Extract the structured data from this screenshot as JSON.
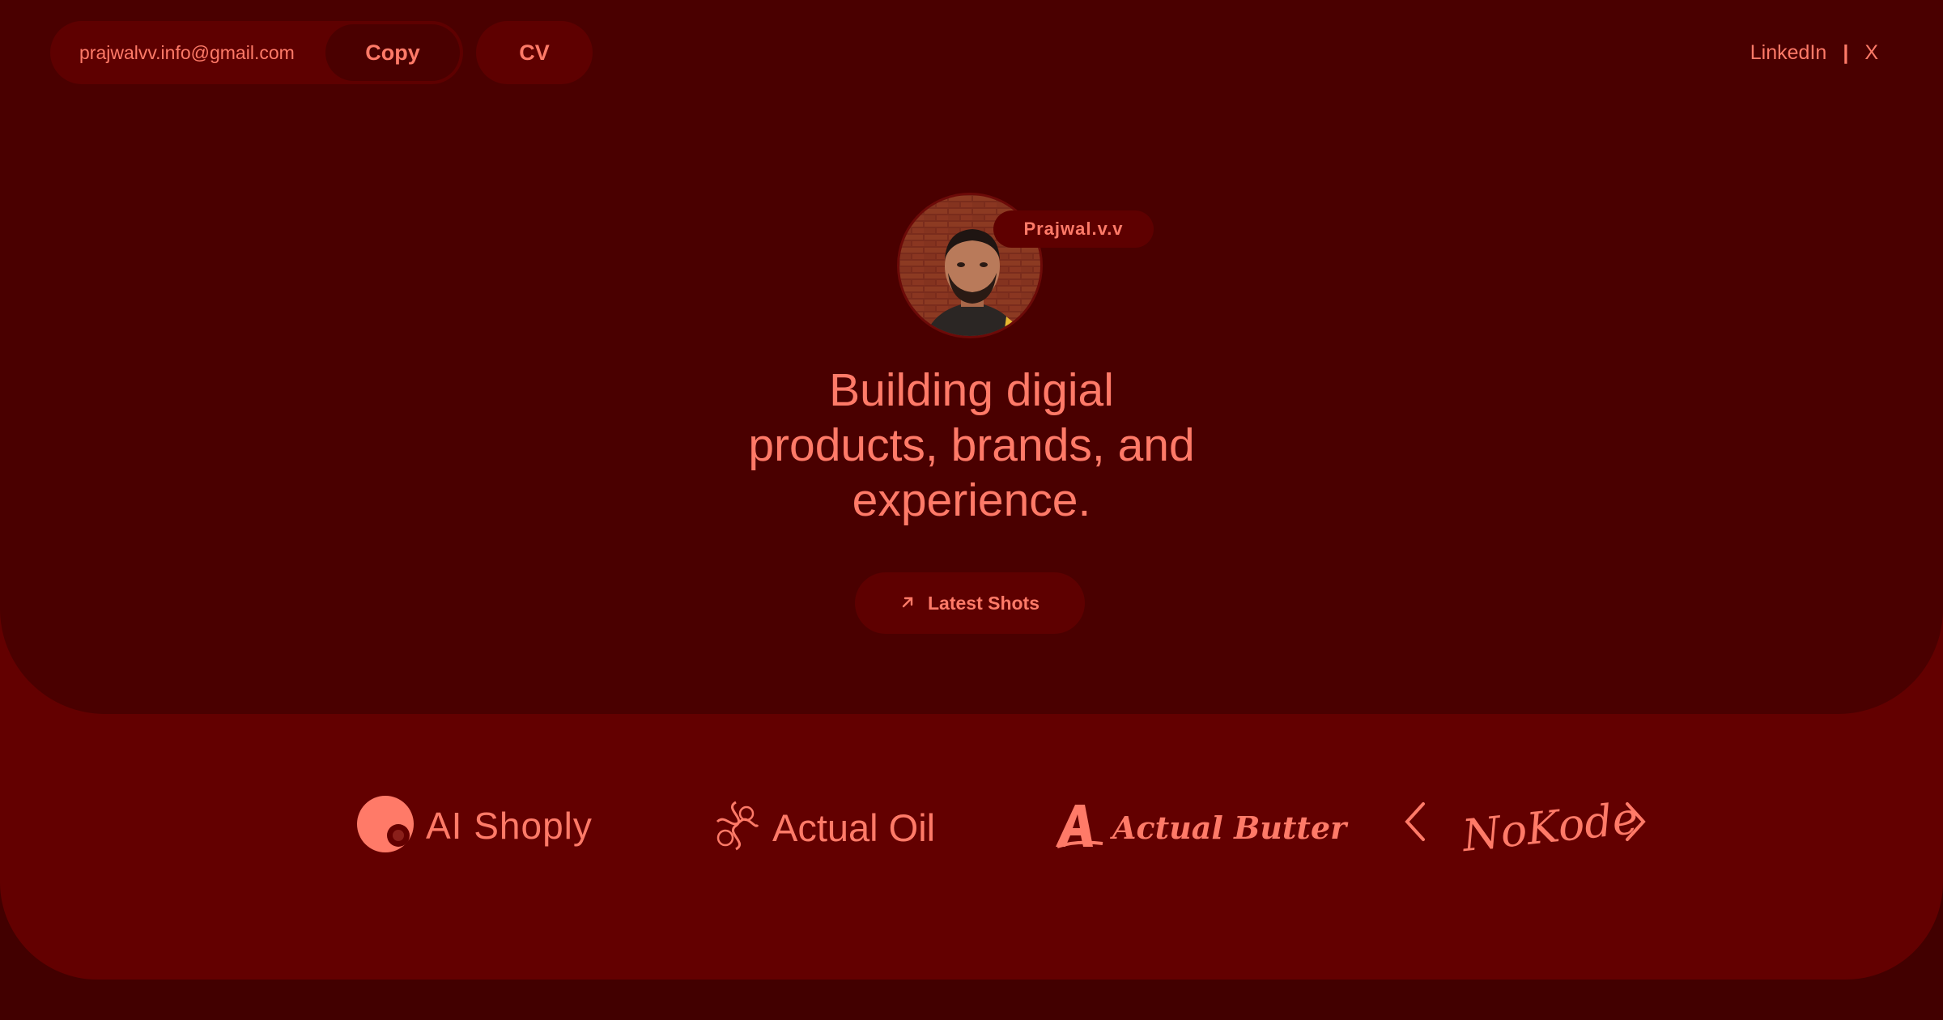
{
  "header": {
    "email": "prajwalvv.info@gmail.com",
    "copy_label": "Copy",
    "cv_label": "CV",
    "links": {
      "linkedin": "LinkedIn",
      "separator": "|",
      "x": "X"
    }
  },
  "profile": {
    "name": "Prajwal.v.v",
    "avatar_icon": "portrait-photo"
  },
  "hero": {
    "headline_lines": [
      "Building digial",
      "products, brands, and",
      "experience."
    ],
    "cta_label": "Latest Shots",
    "cta_icon": "arrow-up-right-icon"
  },
  "logos": [
    {
      "name": "AI Shoply",
      "icon": "shoply-mark-icon"
    },
    {
      "name": "Actual Oil",
      "icon": "ornament-monogram-icon"
    },
    {
      "name": "Actual Butter",
      "icon": "a-letter-mark-icon"
    },
    {
      "name": "NoKode",
      "icon": "script-wordmark"
    }
  ],
  "carousel": {
    "prev_icon": "chevron-left-icon",
    "next_icon": "chevron-right-icon"
  },
  "colors": {
    "page_bg": "#420000",
    "hero_bg": "#4a0000",
    "band_bg": "#630000",
    "pill_bg": "#5e0000",
    "accent_text": "#ff7a68"
  }
}
